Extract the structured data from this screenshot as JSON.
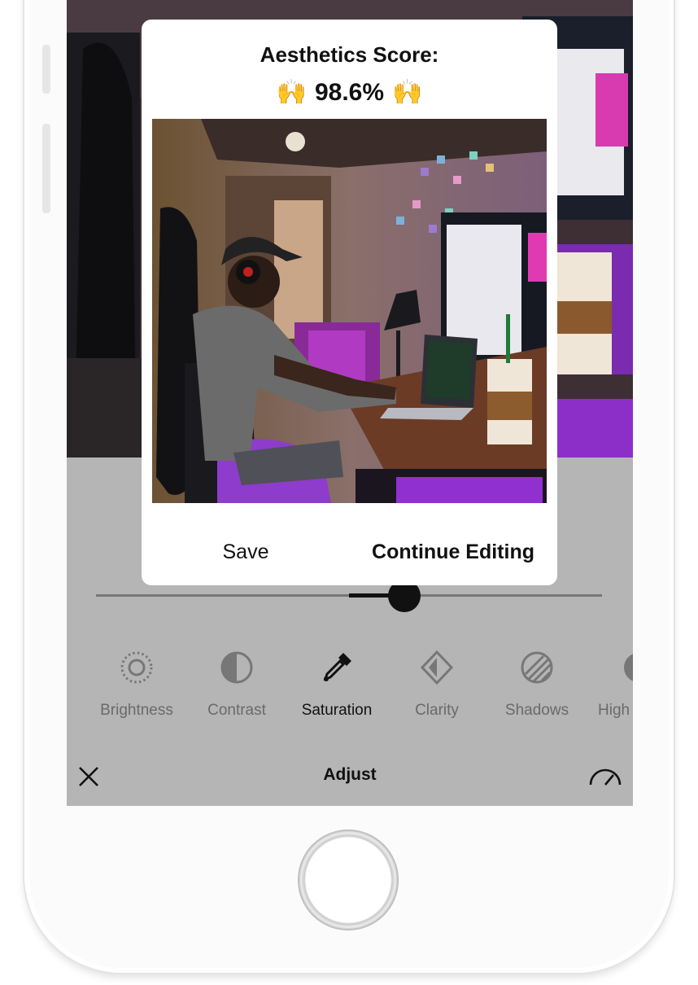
{
  "modal": {
    "score_title": "Aesthetics Score:",
    "score_emoji_left": "🙌",
    "score_value": "98.6%",
    "score_emoji_right": "🙌",
    "save_label": "Save",
    "continue_label": "Continue Editing"
  },
  "slider": {
    "value_fraction": 0.61
  },
  "tools": [
    {
      "label": "Brightness",
      "icon": "brightness-icon"
    },
    {
      "label": "Contrast",
      "icon": "contrast-icon"
    },
    {
      "label": "Saturation",
      "icon": "eyedropper-icon",
      "active": true
    },
    {
      "label": "Clarity",
      "icon": "clarity-icon"
    },
    {
      "label": "Shadows",
      "icon": "shadows-icon"
    },
    {
      "label": "High",
      "icon": "highlights-icon"
    }
  ],
  "bottom_bar": {
    "title": "Adjust",
    "close_icon": "close-icon",
    "gauge_icon": "gauge-icon"
  },
  "colors": {
    "screen_bg": "#b5b5b5",
    "accent_purple": "#9b2fd6",
    "modal_bg": "#ffffff"
  }
}
